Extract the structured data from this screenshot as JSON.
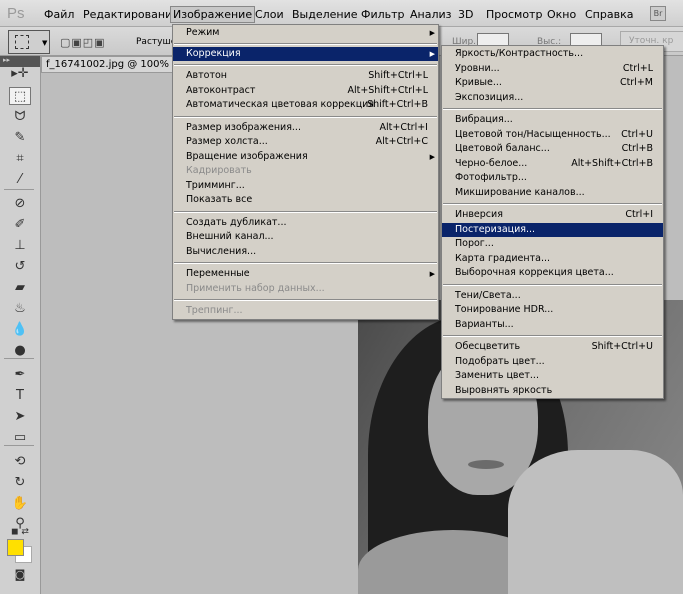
{
  "app": {
    "logo": "Ps",
    "bridge": "Br"
  },
  "menubar": [
    "Файл",
    "Редактирование",
    "Изображение",
    "Слои",
    "Выделение",
    "Фильтр",
    "Анализ",
    "3D",
    "Просмотр",
    "Окно",
    "Справка"
  ],
  "options": {
    "feather_label": "Растуше",
    "width_label": "Шир.:",
    "height_label": "Выс.:",
    "refine_label": "Уточн. кр"
  },
  "document": {
    "tab_title": "f_16741002.jpg @ 100% (G"
  },
  "colors": {
    "foreground": "#ffe000",
    "background": "#ffffff",
    "highlight": "#0a246a"
  },
  "image_menu": [
    [
      {
        "label": "Режим",
        "submenu": true
      }
    ],
    [
      {
        "label": "Коррекция",
        "submenu": true,
        "highlighted": true
      }
    ],
    [
      {
        "label": "Автотон",
        "shortcut": "Shift+Ctrl+L"
      },
      {
        "label": "Автоконтраст",
        "shortcut": "Alt+Shift+Ctrl+L"
      },
      {
        "label": "Автоматическая цветовая коррекция",
        "shortcut": "Shift+Ctrl+B"
      }
    ],
    [
      {
        "label": "Размер изображения...",
        "shortcut": "Alt+Ctrl+I"
      },
      {
        "label": "Размер холста...",
        "shortcut": "Alt+Ctrl+C"
      },
      {
        "label": "Вращение изображения",
        "submenu": true
      },
      {
        "label": "Кадрировать",
        "disabled": true
      },
      {
        "label": "Тримминг..."
      },
      {
        "label": "Показать все"
      }
    ],
    [
      {
        "label": "Создать дубликат..."
      },
      {
        "label": "Внешний канал..."
      },
      {
        "label": "Вычисления..."
      }
    ],
    [
      {
        "label": "Переменные",
        "submenu": true
      },
      {
        "label": "Применить набор данных...",
        "disabled": true
      }
    ],
    [
      {
        "label": "Треппинг...",
        "disabled": true
      }
    ]
  ],
  "adjust_menu": [
    [
      {
        "label": "Яркость/Контрастность..."
      },
      {
        "label": "Уровни...",
        "shortcut": "Ctrl+L"
      },
      {
        "label": "Кривые...",
        "shortcut": "Ctrl+M"
      },
      {
        "label": "Экспозиция..."
      }
    ],
    [
      {
        "label": "Вибрация..."
      },
      {
        "label": "Цветовой тон/Насыщенность...",
        "shortcut": "Ctrl+U"
      },
      {
        "label": "Цветовой баланс...",
        "shortcut": "Ctrl+B"
      },
      {
        "label": "Черно-белое...",
        "shortcut": "Alt+Shift+Ctrl+B"
      },
      {
        "label": "Фотофильтр..."
      },
      {
        "label": "Микширование каналов..."
      }
    ],
    [
      {
        "label": "Инверсия",
        "shortcut": "Ctrl+I"
      },
      {
        "label": "Постеризация...",
        "highlighted": true
      },
      {
        "label": "Порог..."
      },
      {
        "label": "Карта градиента..."
      },
      {
        "label": "Выборочная коррекция цвета..."
      }
    ],
    [
      {
        "label": "Тени/Света..."
      },
      {
        "label": "Тонирование HDR..."
      },
      {
        "label": "Варианты..."
      }
    ],
    [
      {
        "label": "Обесцветить",
        "shortcut": "Shift+Ctrl+U"
      },
      {
        "label": "Подобрать цвет..."
      },
      {
        "label": "Заменить цвет..."
      },
      {
        "label": "Выровнять яркость"
      }
    ]
  ],
  "tools": [
    {
      "name": "move-tool",
      "glyph": "▸✛"
    },
    {
      "name": "marquee-tool",
      "glyph": "⬚",
      "selected": true
    },
    {
      "name": "lasso-tool",
      "glyph": "ᗢ"
    },
    {
      "name": "quick-select-tool",
      "glyph": "✎"
    },
    {
      "name": "crop-tool",
      "glyph": "⌗"
    },
    {
      "name": "eyedropper-tool",
      "glyph": "⁄"
    },
    {
      "name": "healing-tool",
      "glyph": "⊘"
    },
    {
      "name": "brush-tool",
      "glyph": "✐"
    },
    {
      "name": "stamp-tool",
      "glyph": "⊥"
    },
    {
      "name": "history-brush-tool",
      "glyph": "↺"
    },
    {
      "name": "eraser-tool",
      "glyph": "▰"
    },
    {
      "name": "bucket-tool",
      "glyph": "♨"
    },
    {
      "name": "blur-tool",
      "glyph": "💧"
    },
    {
      "name": "dodge-tool",
      "glyph": "●"
    },
    {
      "name": "pen-tool",
      "glyph": "✒"
    },
    {
      "name": "type-tool",
      "glyph": "T"
    },
    {
      "name": "path-select-tool",
      "glyph": "➤"
    },
    {
      "name": "shape-tool",
      "glyph": "▭"
    },
    {
      "name": "3d-rotate-tool",
      "glyph": "⟲"
    },
    {
      "name": "3d-orbit-tool",
      "glyph": "↻"
    },
    {
      "name": "hand-tool",
      "glyph": "✋"
    },
    {
      "name": "zoom-tool",
      "glyph": "⚲"
    }
  ]
}
